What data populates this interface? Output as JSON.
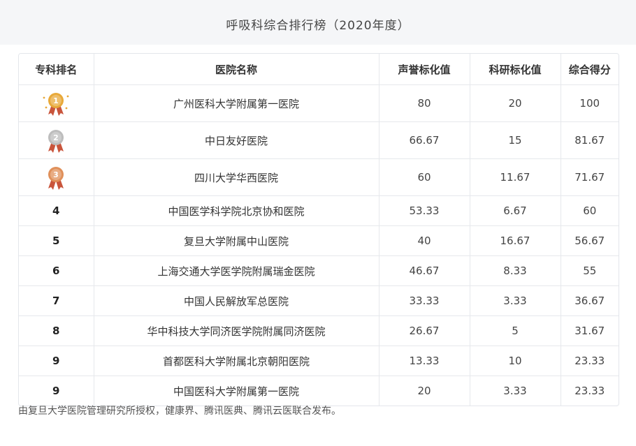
{
  "title": "呼吸科综合排行榜（2020年度）",
  "table": {
    "headers": [
      "专科排名",
      "医院名称",
      "声誉标化值",
      "科研标化值",
      "综合得分"
    ],
    "rows": [
      {
        "rank": "1",
        "medal": "gold",
        "name": "广州医科大学附属第一医院",
        "reputation": "80",
        "research": "20",
        "score": "100"
      },
      {
        "rank": "2",
        "medal": "silver",
        "name": "中日友好医院",
        "reputation": "66.67",
        "research": "15",
        "score": "81.67"
      },
      {
        "rank": "3",
        "medal": "bronze",
        "name": "四川大学华西医院",
        "reputation": "60",
        "research": "11.67",
        "score": "71.67"
      },
      {
        "rank": "4",
        "name": "中国医学科学院北京协和医院",
        "reputation": "53.33",
        "research": "6.67",
        "score": "60"
      },
      {
        "rank": "5",
        "name": "复旦大学附属中山医院",
        "reputation": "40",
        "research": "16.67",
        "score": "56.67"
      },
      {
        "rank": "6",
        "name": "上海交通大学医学院附属瑞金医院",
        "reputation": "46.67",
        "research": "8.33",
        "score": "55"
      },
      {
        "rank": "7",
        "name": "中国人民解放军总医院",
        "reputation": "33.33",
        "research": "3.33",
        "score": "36.67"
      },
      {
        "rank": "8",
        "name": "华中科技大学同济医学院附属同济医院",
        "reputation": "26.67",
        "research": "5",
        "score": "31.67"
      },
      {
        "rank": "9",
        "name": "首都医科大学附属北京朝阳医院",
        "reputation": "13.33",
        "research": "10",
        "score": "23.33"
      },
      {
        "rank": "9",
        "name": "中国医科大学附属第一医院",
        "reputation": "20",
        "research": "3.33",
        "score": "23.33"
      }
    ]
  },
  "footer": "由复旦大学医院管理研究所授权，健康界、腾讯医典、腾讯云医联合发布。",
  "colors": {
    "gold": "#e8a93a",
    "silver": "#bdbdbd",
    "bronze": "#e0905a",
    "ribbon": "#c9553c"
  }
}
